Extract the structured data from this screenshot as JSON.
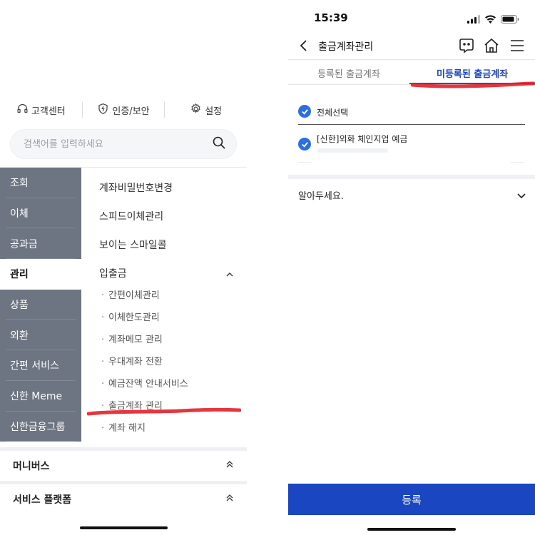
{
  "left": {
    "quick_links": [
      {
        "label": "고객센터",
        "icon": "headset-icon"
      },
      {
        "label": "인증/보안",
        "icon": "shield-icon"
      },
      {
        "label": "설정",
        "icon": "gear-icon"
      }
    ],
    "search": {
      "placeholder": "검색어를 입력하세요",
      "icon": "search-icon"
    },
    "categories": [
      "조회",
      "이체",
      "공과금",
      "관리",
      "상품",
      "외환",
      "간편 서비스",
      "신한 Meme",
      "신한금융그룹"
    ],
    "active_category": "관리",
    "submenu": [
      "계좌비밀번호변경",
      "스피드이체관리",
      "보이는 스마일콜",
      "입출금"
    ],
    "submenu_expanded": "입출금",
    "sub_items": [
      "간편이체관리",
      "이체한도관리",
      "계좌메모 관리",
      "우대계좌 전환",
      "예금잔액 안내서비스",
      "출금계좌 관리",
      "계좌 해지"
    ],
    "accordions": [
      "머니버스",
      "서비스 플랫폼"
    ],
    "highlight_color": "#e0202a"
  },
  "right": {
    "status": {
      "time": "15:39"
    },
    "nav": {
      "title": "출금계좌관리",
      "icons": [
        "back-icon",
        "chat-icon",
        "home-icon",
        "menu-icon"
      ]
    },
    "tabs": [
      "등록된 출금계좌",
      "미등록된 출금계좌"
    ],
    "active_tab": "미등록된 출금계좌",
    "select_all": "전체선택",
    "account": "[신한]외화 체인지업 예금",
    "notice": "알아두세요.",
    "register_button": "등록",
    "accent": "#1a46c2"
  }
}
